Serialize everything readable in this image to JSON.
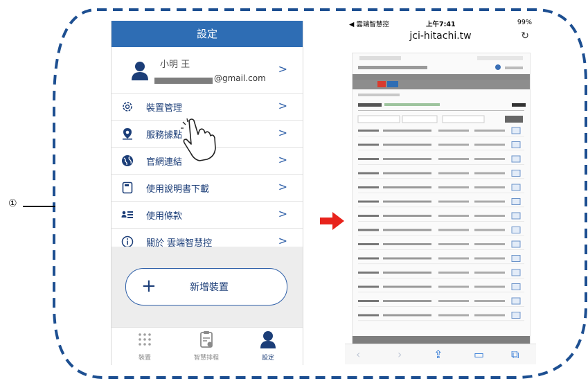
{
  "callout": {
    "number": "①"
  },
  "settings_screen": {
    "title": "設定",
    "profile": {
      "name": "小明 王",
      "email_visible": "@gmail.com"
    },
    "menu": [
      {
        "icon": "gear-icon",
        "label": "裝置管理"
      },
      {
        "icon": "map-pin-icon",
        "label": "服務據點"
      },
      {
        "icon": "globe-icon",
        "label": "官網連結"
      },
      {
        "icon": "document-icon",
        "label": "使用說明書下載"
      },
      {
        "icon": "terms-list-icon",
        "label": "使用條款"
      },
      {
        "icon": "info-icon",
        "label": "關於 雲端智慧控"
      }
    ],
    "add_device_label": "新增裝置",
    "tabs": [
      {
        "icon": "dots-grid-icon",
        "label": "裝置",
        "active": false
      },
      {
        "icon": "clipboard-icon",
        "label": "智慧排程",
        "active": false
      },
      {
        "icon": "person-icon",
        "label": "設定",
        "active": true
      }
    ],
    "accent_color": "#2e6db4"
  },
  "arrow_color": "#e8231c",
  "browser_screen": {
    "carrier": "◀ 雲端智慧控",
    "time": "上午7:41",
    "battery": "99%",
    "url": "jci-hitachi.tw",
    "accent_color": "#2f78d6"
  }
}
